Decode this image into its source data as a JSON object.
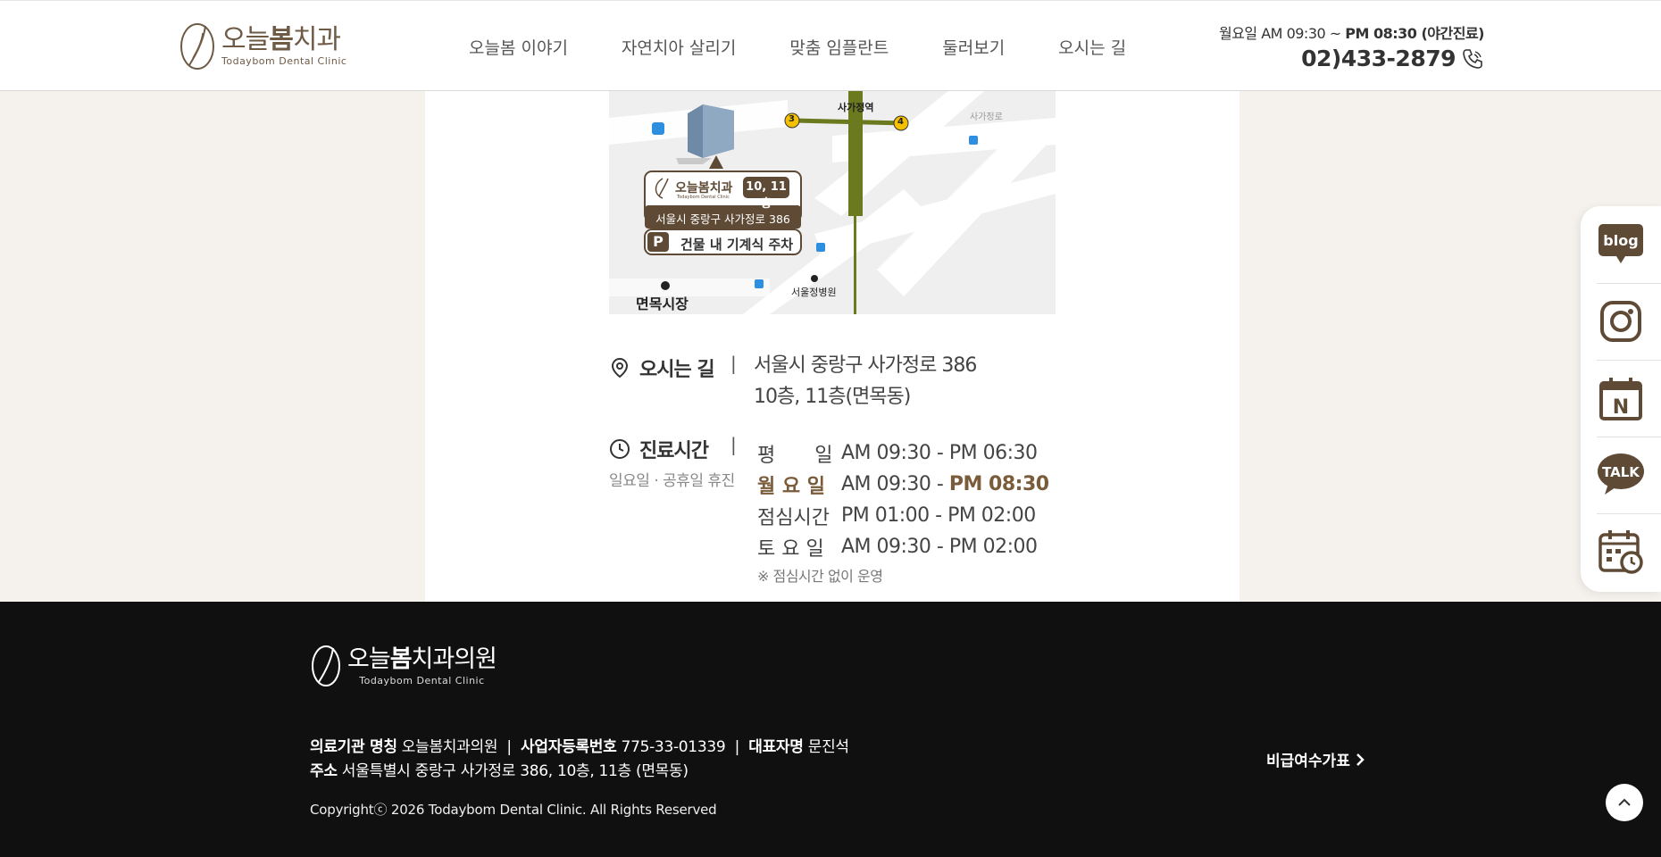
{
  "header": {
    "logo_ko_prefix": "오늘",
    "logo_ko_bold": "봄",
    "logo_ko_suffix": "치과",
    "logo_en": "Todaybom Dental Clinic",
    "nav": [
      "오늘봄 이야기",
      "자연치아 살리기",
      "맞춤 임플란트",
      "둘러보기",
      "오시는 길"
    ],
    "hours_prefix": "월요일 AM 09:30 ~ ",
    "hours_bold": "PM 08:30 (야간진료)",
    "phone": "02)433-2879",
    "phone_icon": "phone-icon"
  },
  "map": {
    "station": "사가정역",
    "exit_3": "3",
    "exit_4": "4",
    "street_label": "사가정로",
    "logo_ko": "오늘봄치과",
    "logo_en": "Todaybom Dental Clinic",
    "floors": "10, 11층",
    "address": "서울시 중랑구 사가정로 386",
    "parking_p": "P",
    "parking": "건물 내 기계식 주차",
    "market": "면목시장",
    "hospital": "서울정병원"
  },
  "location": {
    "label": "오시는 길",
    "sep": "|",
    "address_line1": "서울시 중랑구 사가정로 386",
    "address_line2": "10층, 11층(면목동)"
  },
  "hours": {
    "label": "진료시간",
    "sep": "|",
    "closed": "일요일 · 공휴일 휴진",
    "rows": [
      {
        "day": "평　　일",
        "time": "AM 09:30 - PM 06:30"
      },
      {
        "day": "월 요 일",
        "time_am": "AM 09:30 - ",
        "time_pm": "PM 08:30"
      },
      {
        "day": "점심시간",
        "time": "PM 01:00 - PM 02:00"
      },
      {
        "day": "토 요 일",
        "time": "AM 09:30 - PM 02:00"
      }
    ],
    "note": "※ 점심시간 없이 운영"
  },
  "quickbar": {
    "items": [
      "blog-icon",
      "instagram-icon",
      "naver-icon",
      "kakao-talk-icon",
      "reservation-calendar-icon"
    ],
    "blog_text": "blog",
    "talk_text": "TALK",
    "naver_text": "N"
  },
  "footer": {
    "logo_ko_prefix": "오늘",
    "logo_ko_bold": "봄",
    "logo_ko_suffix": "치과의원",
    "logo_en": "Todaybom Dental Clinic",
    "name_label": "의료기관 명칭",
    "name_value": "오늘봄치과의원",
    "sep": "|",
    "biz_label": "사업자등록번호",
    "biz_value": "775-33-01339",
    "rep_label": "대표자명",
    "rep_value": "문진석",
    "addr_label": "주소",
    "addr_value": "서울특별시 중랑구 사가정로 386, 10층, 11층 (면목동)",
    "copyright": "Copyrightⓒ 2026 Todaybom Dental Clinic. All Rights Reserved",
    "fee_link": "비급여수가표"
  },
  "colors": {
    "brand_brown": "#6e5a45",
    "accent_brown": "#7a5c3a",
    "map_green": "#6b7a1f",
    "footer_bg": "#111010",
    "page_bg": "#f5f1ec"
  }
}
